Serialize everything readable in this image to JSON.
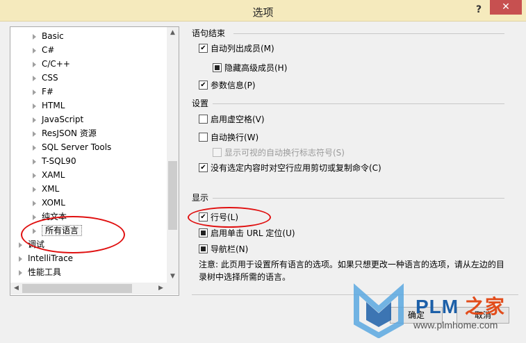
{
  "window": {
    "title": "选项",
    "help": "?",
    "close": "✕"
  },
  "tree": {
    "items": [
      {
        "label": "Basic"
      },
      {
        "label": "C#"
      },
      {
        "label": "C/C++"
      },
      {
        "label": "CSS"
      },
      {
        "label": "F#"
      },
      {
        "label": "HTML"
      },
      {
        "label": "JavaScript"
      },
      {
        "label": "ResJSON 资源"
      },
      {
        "label": "SQL Server Tools"
      },
      {
        "label": "T-SQL90"
      },
      {
        "label": "XAML"
      },
      {
        "label": "XML"
      },
      {
        "label": "XOML"
      },
      {
        "label": "纯文本"
      },
      {
        "label": "所有语言"
      },
      {
        "label": "调试"
      },
      {
        "label": "IntelliTrace"
      },
      {
        "label": "性能工具"
      }
    ],
    "selected": "所有语言"
  },
  "sections": {
    "statement": "语句结束",
    "settings": "设置",
    "display": "显示"
  },
  "options": {
    "auto_list_members": "自动列出成员(M)",
    "hide_advanced": "隐藏高级成员(H)",
    "param_info": "参数信息(P)",
    "virtual_space": "启用虚空格(V)",
    "word_wrap": "自动换行(W)",
    "show_wrap_glyphs": "显示可视的自动换行标志符号(S)",
    "copy_without_selection": "没有选定内容时对空行应用剪切或复制命令(C)",
    "line_numbers": "行号(L)",
    "single_click_url": "启用单击 URL 定位(U)",
    "nav_bar": "导航栏(N)"
  },
  "note": "注意: 此页用于设置所有语言的选项。如果只想更改一种语言的选项，请从左边的目录树中选择所需的语言。",
  "buttons": {
    "ok": "确定",
    "cancel": "取消"
  },
  "watermark": {
    "brand": "PLM",
    "brand_cn": "之家",
    "url": "www.plmhome.com"
  },
  "colors": {
    "titlebar": "#f5eabd",
    "close": "#c75050",
    "annotation": "#e01010",
    "brand": "#1c5fa8"
  }
}
